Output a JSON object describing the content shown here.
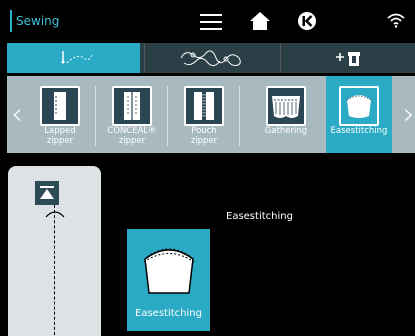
{
  "header": {
    "title": "Sewing",
    "accent_color": "#2aaac4"
  },
  "tabs": [
    {
      "name": "utility-stitches",
      "active": true
    },
    {
      "name": "decorative-stitches",
      "active": false
    },
    {
      "name": "sewing-techniques",
      "active": false
    }
  ],
  "stitch_strip": {
    "items": [
      {
        "label": "Lapped\nzipper",
        "selected": false
      },
      {
        "label": "CONCEAL®\nzipper",
        "selected": false
      },
      {
        "label": "Pouch\nzipper",
        "selected": false
      },
      {
        "label": "Gathering",
        "selected": false
      },
      {
        "label": "Easestitching",
        "selected": true
      }
    ]
  },
  "main": {
    "stitch_name": "Easestitching",
    "card_label": "Easestitching"
  }
}
